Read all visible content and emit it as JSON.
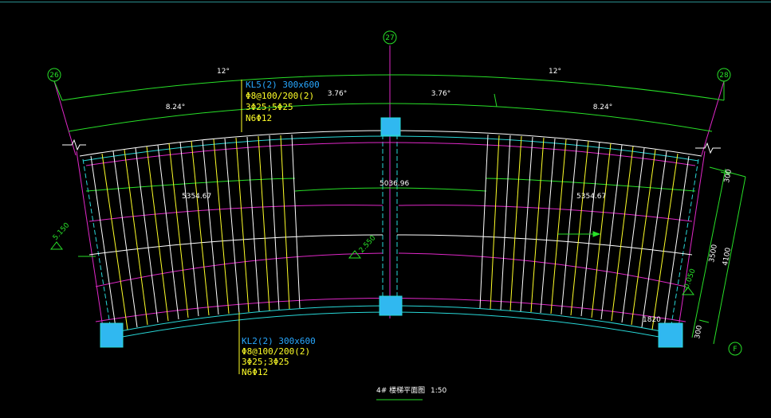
{
  "drawing": {
    "axes": {
      "left": "26",
      "middle": "27",
      "right": "28",
      "bottom_right": "F"
    },
    "angles": {
      "top_left": "12°",
      "top_right": "12°",
      "inner_left": "8.24°",
      "inner_mid_left": "3.76°",
      "inner_mid_right": "3.76°",
      "inner_right": "8.24°"
    },
    "beam_top": {
      "name": "KL5(2) 300x600",
      "stirrup": "Φ8@100/200(2)",
      "main": "3Φ25;5Φ25",
      "side": "N6Φ12"
    },
    "beam_bottom": {
      "name": "KL2(2) 300x600",
      "stirrup": "Φ8@100/200(2)",
      "main": "3Φ25;3Φ25",
      "side": "N6Φ12"
    },
    "dims": {
      "left_span": "5354.67",
      "mid_span": "5036.96",
      "right_span": "5354.67",
      "right_total": "4100",
      "right_top": "300",
      "right_mid": "3500",
      "right_bottom": "300"
    },
    "elevations": {
      "left": "5.150",
      "center": "2.550",
      "right": "-0.050"
    },
    "note_right": "1820",
    "title": "4# 楼梯平面图",
    "scale": "1:50",
    "colors": {
      "green": "#28e028",
      "cyan": "#28d8d8",
      "magenta": "#e028c8",
      "yellow": "#ffff28",
      "white": "#ffffff",
      "blue_label": "#28a8ff",
      "column": "#30b8f0"
    }
  }
}
